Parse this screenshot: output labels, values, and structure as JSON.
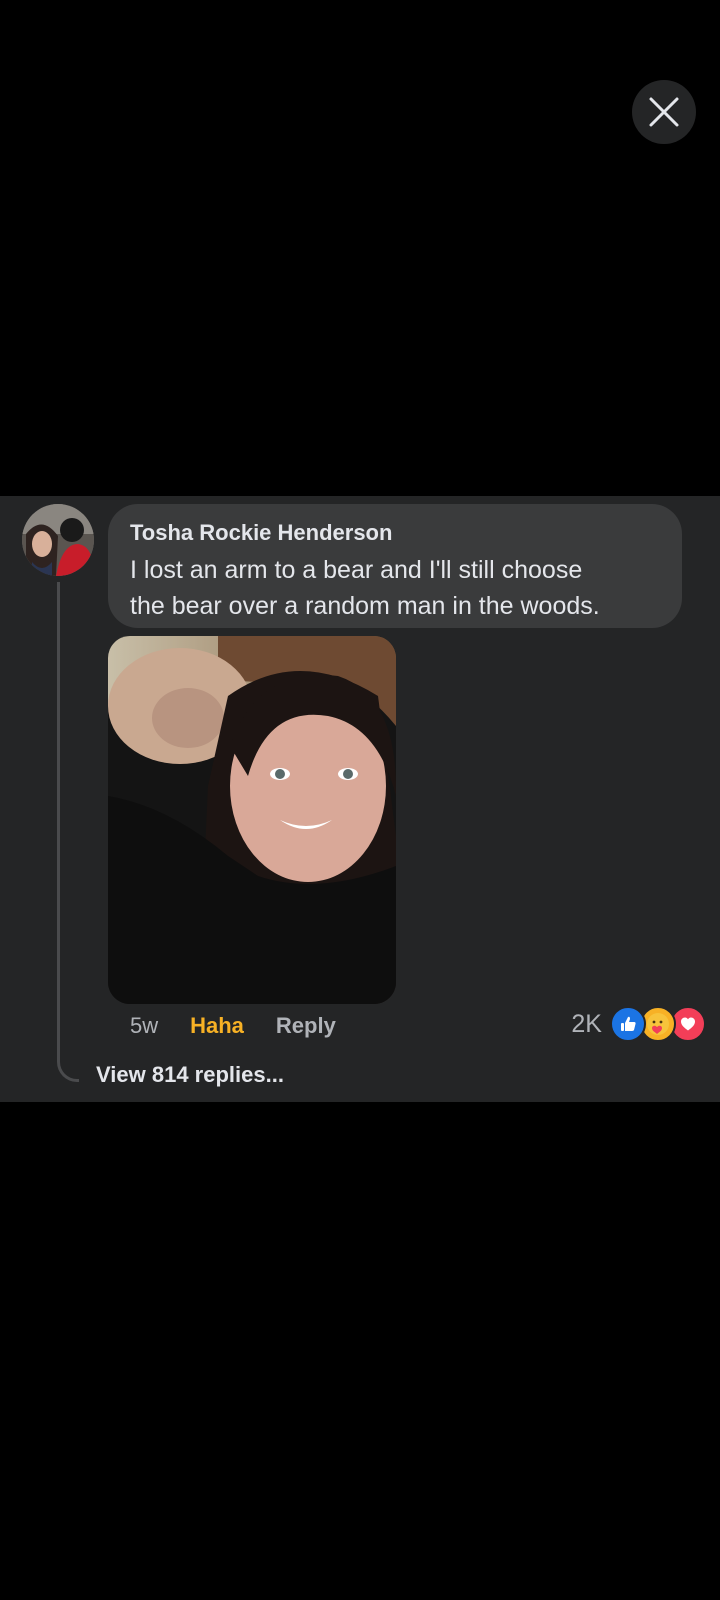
{
  "comment": {
    "author": "Tosha Rockie Henderson",
    "text_line_1": "I lost an arm to a bear and I'll still choose",
    "text_line_2": "the bear over a random man in the woods.",
    "timestamp": "5w",
    "reaction_label": "Haha",
    "reply_label": "Reply",
    "reaction_count": "2K",
    "reaction_icons": [
      "like-icon",
      "care-icon",
      "love-icon"
    ],
    "view_replies_label": "View 814 replies..."
  },
  "colors": {
    "background": "#000000",
    "card": "#242526",
    "bubble": "#3a3b3c",
    "text_primary": "#e4e6eb",
    "text_secondary": "#b0b3b8",
    "haha_accent": "#f7b125",
    "like_blue": "#1b74e4",
    "love_red": "#f33e58"
  }
}
